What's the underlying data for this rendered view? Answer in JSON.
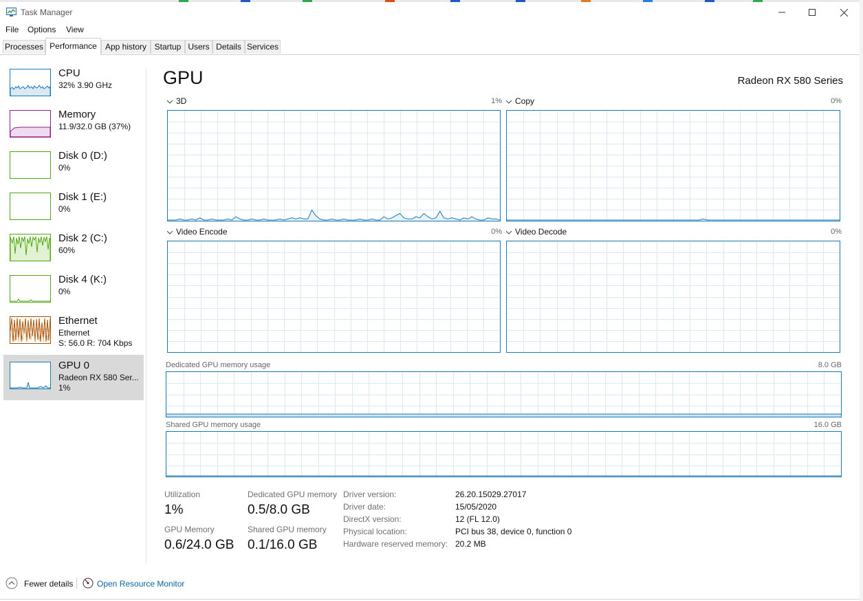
{
  "window": {
    "title": "Task Manager"
  },
  "menu": [
    "File",
    "Options",
    "View"
  ],
  "tabs": [
    "Processes",
    "Performance",
    "App history",
    "Startup",
    "Users",
    "Details",
    "Services"
  ],
  "active_tab": "Performance",
  "sidebar": [
    {
      "name": "CPU",
      "line1": "32%  3.90 GHz",
      "line2": "",
      "color": "#1779b8"
    },
    {
      "name": "Memory",
      "line1": "11.9/32.0 GB (37%)",
      "line2": "",
      "color": "#8b1a8b"
    },
    {
      "name": "Disk 0 (D:)",
      "line1": "0%",
      "line2": "",
      "color": "#4da60c"
    },
    {
      "name": "Disk 1 (E:)",
      "line1": "0%",
      "line2": "",
      "color": "#4da60c"
    },
    {
      "name": "Disk 2 (C:)",
      "line1": "60%",
      "line2": "",
      "color": "#4da60c"
    },
    {
      "name": "Disk 4 (K:)",
      "line1": "0%",
      "line2": "",
      "color": "#4da60c"
    },
    {
      "name": "Ethernet",
      "line1": "Ethernet",
      "line2": "S: 56.0  R: 704 Kbps",
      "color": "#a74f01"
    },
    {
      "name": "GPU 0",
      "line1": "Radeon RX 580 Ser...",
      "line2": "1%",
      "color": "#1779b8"
    }
  ],
  "main": {
    "title": "GPU",
    "model": "Radeon RX 580 Series",
    "engines": [
      {
        "label": "3D",
        "pct": "1%"
      },
      {
        "label": "Copy",
        "pct": "0%"
      },
      {
        "label": "Video Encode",
        "pct": "0%"
      },
      {
        "label": "Video Decode",
        "pct": "0%"
      }
    ],
    "dedicated_label": "Dedicated GPU memory usage",
    "dedicated_max": "8.0 GB",
    "shared_label": "Shared GPU memory usage",
    "shared_max": "16.0 GB"
  },
  "stats": {
    "utilization_label": "Utilization",
    "utilization": "1%",
    "dedicated_label": "Dedicated GPU memory",
    "dedicated": "0.5/8.0 GB",
    "gpu_memory_label": "GPU Memory",
    "gpu_memory": "0.6/24.0 GB",
    "shared_label": "Shared GPU memory",
    "shared": "0.1/16.0 GB"
  },
  "info": [
    {
      "k": "Driver version:",
      "v": "26.20.15029.27017"
    },
    {
      "k": "Driver date:",
      "v": "15/05/2020"
    },
    {
      "k": "DirectX version:",
      "v": "12 (FL 12.0)"
    },
    {
      "k": "Physical location:",
      "v": "PCI bus 38, device 0, function 0"
    },
    {
      "k": "Hardware reserved memory:",
      "v": "20.2 MB"
    }
  ],
  "footer": {
    "fewer": "Fewer details",
    "monitor": "Open Resource Monitor"
  },
  "colors": {
    "gpu": "#1779b8",
    "link": "#0a64a4"
  },
  "series": {
    "gpu3d": [
      0,
      0,
      0,
      1,
      0,
      0,
      1,
      0,
      2,
      0,
      0,
      1,
      0,
      0,
      0,
      1,
      0,
      3,
      1,
      0,
      0,
      1,
      0,
      0,
      1,
      0,
      0,
      0,
      1,
      0,
      1,
      2,
      1,
      2,
      1,
      1,
      9,
      4,
      1,
      0,
      0,
      1,
      0,
      0,
      1,
      0,
      0,
      0,
      1,
      0,
      0,
      1,
      0,
      0,
      3,
      1,
      2,
      4,
      6,
      2,
      1,
      1,
      3,
      2,
      6,
      3,
      1,
      2,
      8,
      2,
      1,
      2,
      1,
      0,
      2,
      1,
      3,
      1,
      0,
      0,
      2,
      1,
      1,
      0
    ],
    "copy": [
      0,
      0,
      0,
      0,
      0,
      0,
      0,
      0,
      0,
      0,
      0,
      0,
      0,
      0,
      0,
      0,
      0,
      0,
      0,
      0,
      0,
      0,
      0,
      0,
      0,
      0,
      0,
      0,
      0,
      0,
      0,
      0,
      0,
      0,
      0,
      0,
      0,
      0,
      0,
      0,
      0,
      0,
      0,
      0,
      0,
      0,
      0,
      0,
      0,
      1,
      0,
      0,
      0,
      0,
      0,
      0,
      0,
      0,
      0,
      0,
      0,
      0,
      0,
      0,
      0,
      0,
      0,
      0,
      0,
      0,
      0,
      0,
      0,
      0,
      0,
      0,
      0,
      0,
      0,
      0,
      0,
      0,
      0,
      0
    ],
    "dedicated_pct": 6,
    "shared_pct": 0.6
  }
}
